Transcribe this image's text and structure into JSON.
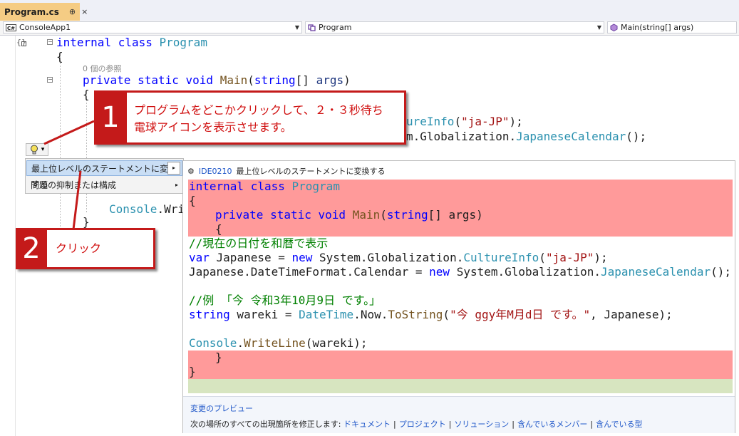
{
  "tab": {
    "title": "Program.cs",
    "pin": "⊕",
    "close": "×"
  },
  "navbar": {
    "project": "ConsoleApp1",
    "project_icon_text": "C#",
    "class": "Program",
    "member": "Main(string[] args)"
  },
  "code": {
    "line1_kw1": "internal",
    "line1_kw2": "class",
    "line1_type": "Program",
    "line2": "{",
    "refs_hint": "0 個の参照",
    "line3_kw1": "private",
    "line3_kw2": "static",
    "line3_kw3": "void",
    "line3_method": "Main",
    "line3_open": "(",
    "line3_kw4": "string",
    "line3_rest": "[] ",
    "line3_param": "args",
    "line3_close": ")",
    "line4": "{",
    "line5_visible_type": "ureInfo",
    "line5_visible_str": "\"ja-JP\"",
    "line5_end": ");",
    "line6_prefix": "m.Globalization.",
    "line6_type": "JapaneseCalendar",
    "line6_end": "();",
    "line_console_type": "Console",
    "line_console_rest": ".Wri",
    "line_close_brace": "}"
  },
  "lightbulb": {
    "icon": "lightbulb-icon",
    "glyph": "💡",
    "dropdown": "▾"
  },
  "menu": {
    "items": [
      {
        "label": "最上位レベルのステートメントに変換する",
        "arrow": "▸",
        "active": true
      },
      {
        "label": "問題の抑制または構成",
        "arrow": "▸",
        "active": false
      }
    ]
  },
  "preview": {
    "header_icon": "⚙",
    "id": "IDE0210",
    "title": "最上位レベルのステートメントに変換する",
    "lines": {
      "l1_kw1": "internal",
      "l1_kw2": "class",
      "l1_type": "Program",
      "l2": "{",
      "l3_kw1": "private",
      "l3_kw2": "static",
      "l3_kw3": "void",
      "l3_method": "Main",
      "l3_open": "(",
      "l3_kw4": "string",
      "l3_rest": "[] args)",
      "l4": "{",
      "l5_comment": "//現在の日付を和暦で表示",
      "l6_kw": "var",
      "l6_a": " Japanese = ",
      "l6_new": "new",
      "l6_b": " System.Globalization.",
      "l6_type": "CultureInfo",
      "l6_open": "(",
      "l6_str": "\"ja-JP\"",
      "l6_end": ");",
      "l7_a": "Japanese.DateTimeFormat.Calendar = ",
      "l7_new": "new",
      "l7_b": " System.Globalization.",
      "l7_type": "JapaneseCalendar",
      "l7_end": "();",
      "l9_comment": "//例 「今 令和3年10月9日 です。」",
      "l10_kw": "string",
      "l10_a": " wareki = ",
      "l10_type": "DateTime",
      "l10_b": ".Now.",
      "l10_method": "ToString",
      "l10_open": "(",
      "l10_str": "\"今 ggy年M月d日 です。\"",
      "l10_end": ", Japanese);",
      "l12_type": "Console",
      "l12_dot": ".",
      "l12_method": "WriteLine",
      "l12_end": "(wareki);",
      "l13": "}",
      "l14": "}"
    },
    "footer_preview_link": "変更のプレビュー",
    "footer_fix_label": "次の場所のすべての出現箇所を修正します:",
    "footer_links": [
      "ドキュメント",
      "プロジェクト",
      "ソリューション",
      "含んでいるメンバー",
      "含んでいる型"
    ],
    "footer_sep": "|"
  },
  "callouts": [
    {
      "number": "1",
      "text_line1": "プログラムをどこかクリックして、２・３秒待ち",
      "text_line2": "電球アイコンを表示させます。"
    },
    {
      "number": "2",
      "text_line1": "クリック"
    }
  ],
  "colors": {
    "accent_red": "#c41a1a",
    "tab_active": "#f5cc84",
    "diff_removed": "#ff9a9a"
  }
}
